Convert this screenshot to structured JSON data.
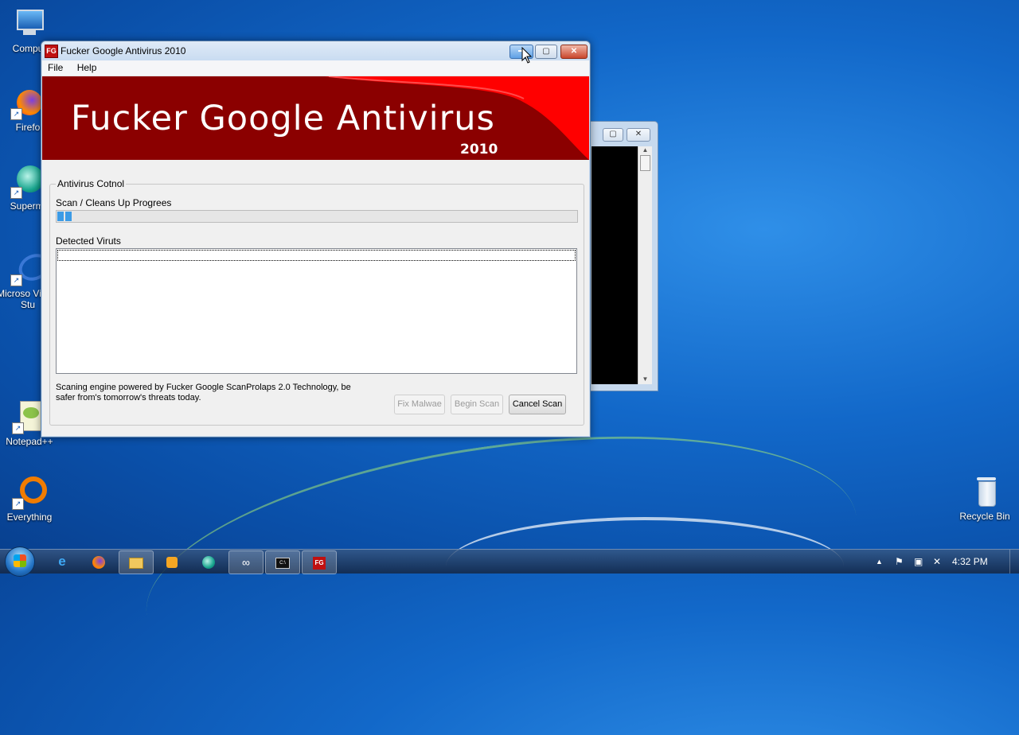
{
  "desktop": {
    "icons": [
      {
        "label": "Compu",
        "icon": "computer-icon"
      },
      {
        "label": "Firefo",
        "icon": "firefox-icon"
      },
      {
        "label": "Supermi",
        "icon": "supermium-icon"
      },
      {
        "label": "Microso Visual Stu",
        "icon": "visual-studio-icon"
      },
      {
        "label": "Notepad++",
        "icon": "notepadpp-icon"
      },
      {
        "label": "Everything",
        "icon": "everything-icon"
      },
      {
        "label": "Recycle Bin",
        "icon": "recycle-bin-icon"
      }
    ]
  },
  "window": {
    "title": "Fucker Google Antivirus 2010",
    "app_icon_text": "FG",
    "menu": [
      "File",
      "Help"
    ],
    "banner": {
      "title": "Fucker Google Antivirus",
      "year": "2010"
    },
    "group_title": "Antivirus Cotnol",
    "progress_label": "Scan / Cleans Up Progrees",
    "progress_value": 0.03,
    "detected_label": "Detected Viruts",
    "footnote": "Scaning engine powered by Fucker Google ScanProlaps 2.0 Technology, be safer from's tomorrow's threats today.",
    "buttons": {
      "fix": "Fix Malwae",
      "begin": "Begin Scan",
      "cancel": "Cancel Scan"
    }
  },
  "taskbar": {
    "items": [
      "ie-icon",
      "firefox-icon",
      "explorer-icon",
      "media-player-icon",
      "supermium-icon",
      "link-icon",
      "console-icon",
      "antivirus-icon"
    ],
    "clock": "4:32 PM"
  },
  "colors": {
    "banner_dark": "#8b0000",
    "banner_red": "#ff0000",
    "progress": "#3c9be6"
  }
}
